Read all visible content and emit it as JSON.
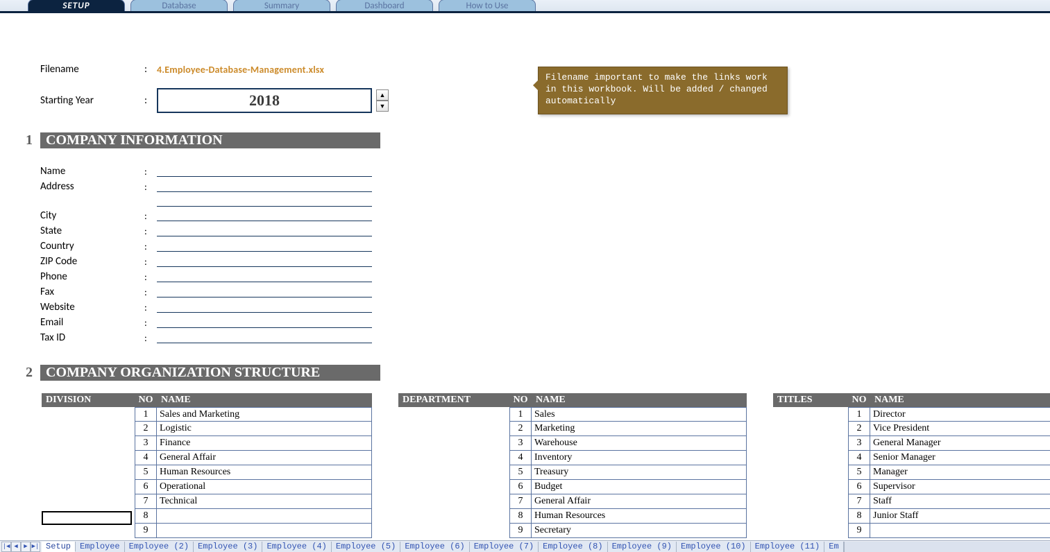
{
  "top_tabs": {
    "active": "SETUP",
    "items": [
      "SETUP",
      "Database",
      "Summary",
      "Dashboard",
      "How to Use"
    ]
  },
  "fields": {
    "filename_label": "Filename",
    "filename_value": "4.Employee-Database-Management.xlsx",
    "starting_year_label": "Starting Year",
    "starting_year_value": "2018"
  },
  "callout_text": "Filename important to make the links work in this workbook. Will be added / changed automatically",
  "section1": {
    "num": "1",
    "title": "COMPANY INFORMATION"
  },
  "company_labels": [
    "Name",
    "Address",
    "",
    "City",
    "State",
    "Country",
    "ZIP Code",
    "Phone",
    "Fax",
    "Website",
    "Email",
    "Tax ID"
  ],
  "section2": {
    "num": "2",
    "title": "COMPANY ORGANIZATION STRUCTURE"
  },
  "tables": {
    "division": {
      "headers": {
        "left": "DIVISION",
        "no": "NO",
        "name": "NAME"
      },
      "rows": [
        {
          "no": "1",
          "name": "Sales and Marketing"
        },
        {
          "no": "2",
          "name": "Logistic"
        },
        {
          "no": "3",
          "name": "Finance"
        },
        {
          "no": "4",
          "name": "General Affair"
        },
        {
          "no": "5",
          "name": "Human Resources"
        },
        {
          "no": "6",
          "name": "Operational"
        },
        {
          "no": "7",
          "name": "Technical"
        },
        {
          "no": "8",
          "name": ""
        },
        {
          "no": "9",
          "name": ""
        }
      ]
    },
    "department": {
      "headers": {
        "left": "DEPARTMENT",
        "no": "NO",
        "name": "NAME"
      },
      "rows": [
        {
          "no": "1",
          "name": "Sales"
        },
        {
          "no": "2",
          "name": "Marketing"
        },
        {
          "no": "3",
          "name": "Warehouse"
        },
        {
          "no": "4",
          "name": "Inventory"
        },
        {
          "no": "5",
          "name": "Treasury"
        },
        {
          "no": "6",
          "name": "Budget"
        },
        {
          "no": "7",
          "name": "General Affair"
        },
        {
          "no": "8",
          "name": "Human Resources"
        },
        {
          "no": "9",
          "name": "Secretary"
        }
      ]
    },
    "titles": {
      "headers": {
        "left": "TITLES",
        "no": "NO",
        "name": "NAME"
      },
      "rows": [
        {
          "no": "1",
          "name": "Director"
        },
        {
          "no": "2",
          "name": "Vice President"
        },
        {
          "no": "3",
          "name": "General Manager"
        },
        {
          "no": "4",
          "name": "Senior Manager"
        },
        {
          "no": "5",
          "name": "Manager"
        },
        {
          "no": "6",
          "name": "Supervisor"
        },
        {
          "no": "7",
          "name": "Staff"
        },
        {
          "no": "8",
          "name": "Junior Staff"
        },
        {
          "no": "9",
          "name": ""
        }
      ]
    }
  },
  "sheet_tabs": {
    "active": "Setup",
    "items": [
      "Setup",
      "Employee",
      "Employee (2)",
      "Employee (3)",
      "Employee (4)",
      "Employee (5)",
      "Employee (6)",
      "Employee (7)",
      "Employee (8)",
      "Employee (9)",
      "Employee (10)",
      "Employee (11)",
      "Em"
    ]
  },
  "colon": ":"
}
